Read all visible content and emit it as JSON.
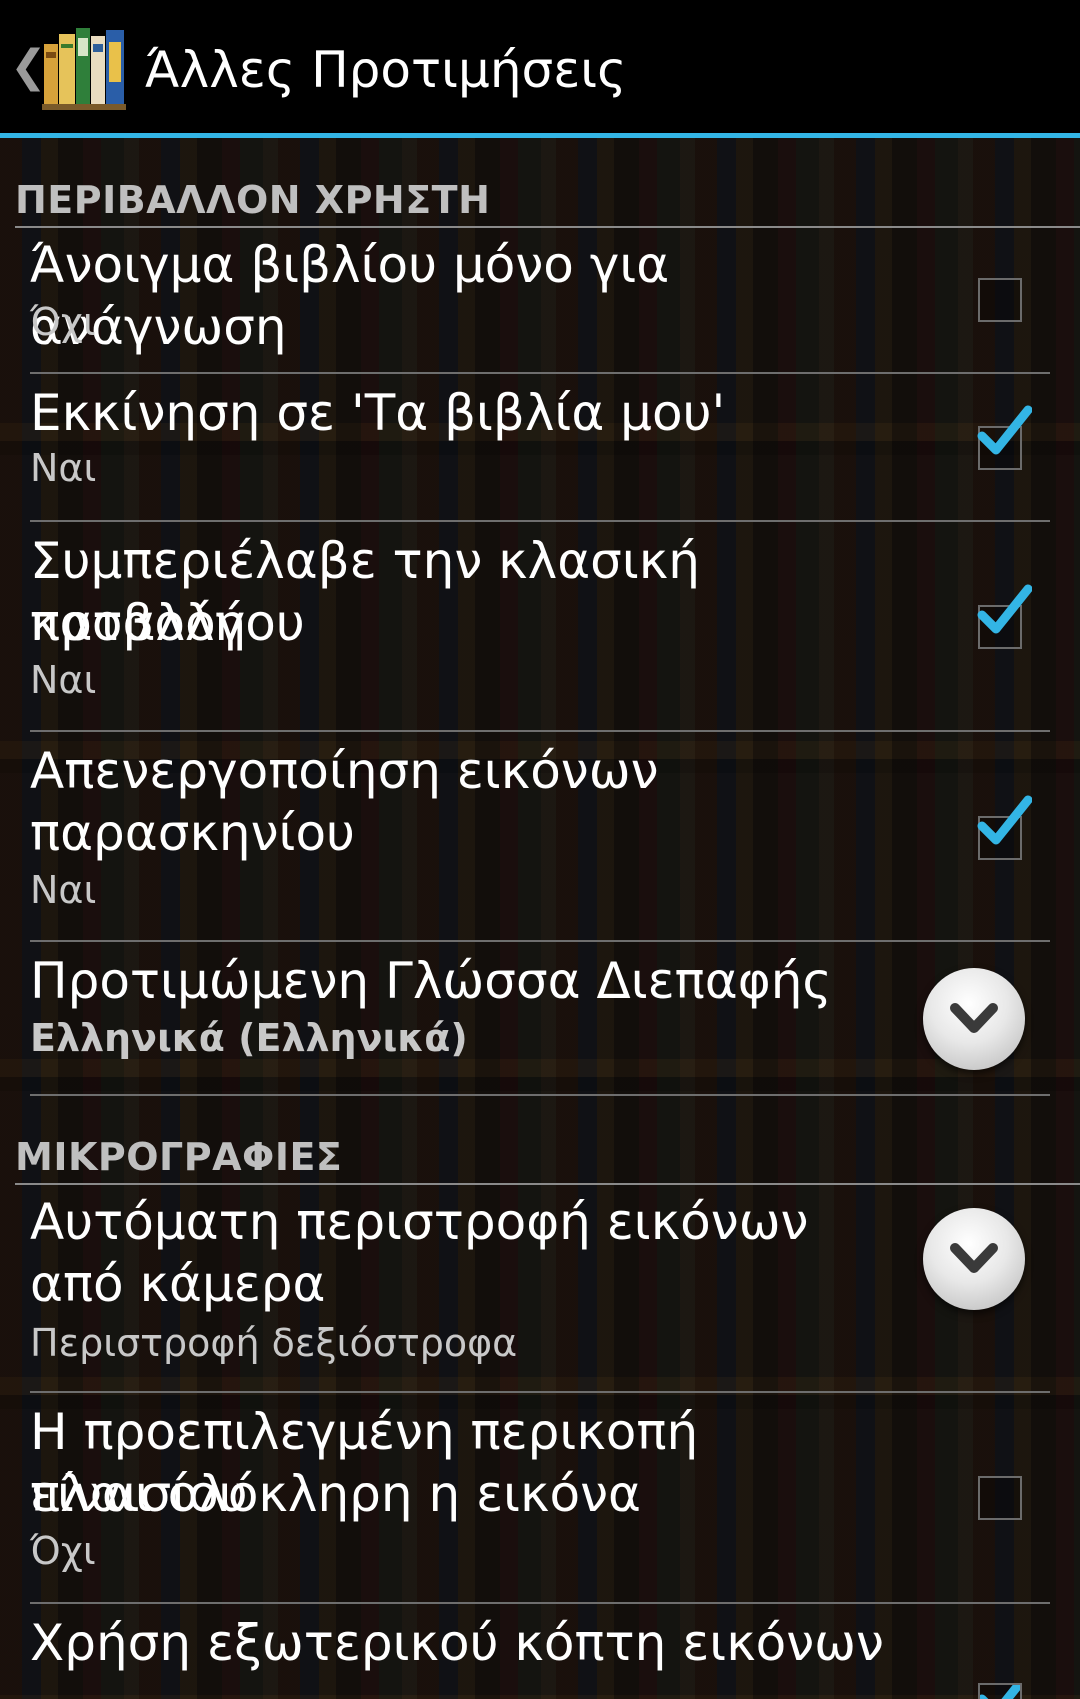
{
  "actionbar": {
    "title": "Άλλες Προτιμήσεις"
  },
  "sections": {
    "user_env": "ΠΕΡΙΒΑΛΛΟΝ ΧΡΗΣΤΗ",
    "thumbnails": "ΜΙΚΡΟΓΡΑΦΙΕΣ"
  },
  "prefs": [
    {
      "title": "Άνοιγμα βιβλίου μόνο για ανάγνωση",
      "summary": "Όχι",
      "control": "checkbox",
      "checked": false
    },
    {
      "title": "Εκκίνηση σε 'Τα βιβλία μου'",
      "summary": "Ναι",
      "control": "checkbox",
      "checked": true
    },
    {
      "title_line1": "Συμπεριέλαβε την κλασική προβολή",
      "title_line2": "καταλόγου",
      "summary": "Ναι",
      "control": "checkbox",
      "checked": true
    },
    {
      "title_line1": "Απενεργοποίηση εικόνων",
      "title_line2": "παρασκηνίου",
      "summary": "Ναι",
      "control": "checkbox",
      "checked": true
    },
    {
      "title": "Προτιμώμενη Γλώσσα Διεπαφής",
      "summary": "Ελληνικά (Ελληνικά)",
      "control": "dropdown"
    },
    {
      "title_line1": "Αυτόματη περιστροφή εικόνων",
      "title_line2": "από κάμερα",
      "summary": "Περιστροφή δεξιόστροφα",
      "control": "dropdown"
    },
    {
      "title_line1": "Η προεπιλεγμένη περικοπή πλαισίου",
      "title_line2": "είναι ολόκληρη η εικόνα",
      "summary": "Όχι",
      "control": "checkbox",
      "checked": false
    },
    {
      "title": "Χρήση εξωτερικού κόπτη εικόνων",
      "control": "checkbox",
      "checked": true
    }
  ],
  "colors": {
    "accent": "#33b5e5",
    "check": "#33b5e5"
  },
  "icons": {
    "back": "back-chevron-icon",
    "app": "bookshelf-app-icon",
    "check": "checkmark-icon",
    "dropdown": "chevron-down-icon"
  }
}
